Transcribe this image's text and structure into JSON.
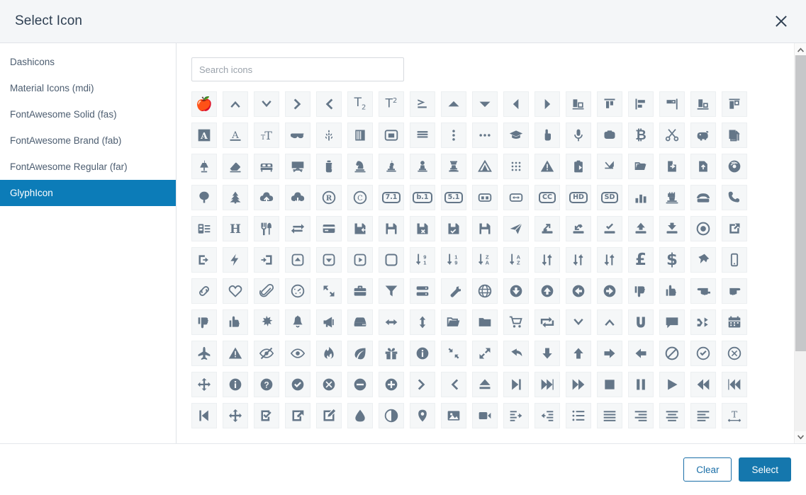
{
  "header": {
    "title": "Select Icon",
    "close_icon": "close-icon"
  },
  "sidebar": {
    "items": [
      {
        "label": "Dashicons",
        "active": false
      },
      {
        "label": "Material Icons (mdi)",
        "active": false
      },
      {
        "label": "FontAwesome Solid (fas)",
        "active": false
      },
      {
        "label": "FontAwesome Brand (fab)",
        "active": false
      },
      {
        "label": "FontAwesome Regular (far)",
        "active": false
      },
      {
        "label": "GlyphIcon",
        "active": true
      }
    ]
  },
  "search": {
    "placeholder": "Search icons",
    "value": ""
  },
  "footer": {
    "clear_label": "Clear",
    "select_label": "Select"
  },
  "colors": {
    "accent": "#0c7cb8",
    "button_primary": "#1577ad",
    "button_outline_text": "#1b6fa8",
    "header_bg": "#f4f6f8",
    "icon_fill": "#647688",
    "icon_cell_bg": "#f5f7f8",
    "title_text": "#2e3f52",
    "sidebar_text": "#4c5d70"
  },
  "scrollbar": {
    "up_arrow_icon": "chevron-up-icon",
    "down_arrow_icon": "chevron-down-icon",
    "thumb_position_percent": 0
  },
  "icon_grid": {
    "columns": 18,
    "font_set": "GlyphIcon",
    "icons": [
      "apple",
      "chevron-up",
      "chevron-down",
      "chevron-right",
      "chevron-left",
      "subscript",
      "superscript",
      "greater-than-equal-terminal",
      "triangle-up",
      "triangle-down",
      "triangle-left",
      "triangle-right",
      "object-align-bottom-right",
      "object-align-top",
      "object-align-left",
      "object-align-horizontal",
      "object-align-bottom",
      "object-align-vertical",
      "text-background",
      "text-color",
      "text-size",
      "sunglasses",
      "wheat",
      "book-binding",
      "modal-window",
      "menu-hamburger",
      "option-vertical",
      "option-horizontal",
      "education",
      "thumbnail-hand",
      "microphone",
      "piggy-bank-side",
      "bitcoin",
      "scissors-cut",
      "piggy-bank",
      "copy-duplicate",
      "lamp",
      "eraser",
      "bed",
      "blackboard",
      "baby-formula",
      "knight",
      "king",
      "pawn",
      "queen",
      "tent",
      "grid-dots",
      "alert-triangle",
      "paste",
      "cut",
      "open-file",
      "import",
      "export",
      "cd",
      "tree-deciduous",
      "tree-conifer",
      "cloud-upload",
      "cloud-download",
      "registration-mark",
      "copyright-mark",
      "btc-7-1",
      "btc-b-1",
      "btc-5-1",
      "subtitles",
      "resize-horizontal-badge",
      "cc-badge",
      "hd-video",
      "sd-video",
      "stats",
      "tower",
      "phone-alt",
      "phone",
      "list-alt-settings",
      "header",
      "cutlery",
      "transfer",
      "credit-card",
      "save-file",
      "save-floppy",
      "save-cancel",
      "save-check",
      "floppy-disk",
      "send",
      "open-remote",
      "import-file",
      "floppy-saved",
      "floppy-open",
      "floppy-save",
      "record",
      "new-window",
      "log-out",
      "flash",
      "log-in",
      "collapse-up",
      "collapse-down",
      "play-circle",
      "unchecked",
      "sort-by-attributes",
      "sort-by-attributes-alt",
      "sort-by-order",
      "sort-by-order-alt",
      "sort-by-alphabet",
      "sort-by-alphabet-alt",
      "sort",
      "gbp",
      "usd",
      "pushpin",
      "phone-mobile",
      "link",
      "heart-empty",
      "paperclip",
      "dashboard",
      "fullscreen",
      "briefcase",
      "filter",
      "hdd-stack",
      "wrench",
      "globe-settings",
      "circle-arrow-down",
      "circle-arrow-up",
      "circle-arrow-left",
      "circle-arrow-right",
      "thumbs-down-alt",
      "hand-up-alt",
      "hand-left",
      "hand-right",
      "thumbs-down",
      "thumbs-up",
      "asterisk-burst",
      "bell",
      "bullhorn",
      "hdd",
      "resize-horizontal",
      "resize-vertical",
      "folder-open",
      "folder-close",
      "shopping-cart",
      "retweet",
      "chevron-down-wide",
      "chevron-up-wide",
      "magnet",
      "comment",
      "random",
      "calendar",
      "plane",
      "warning-sign",
      "eye-close",
      "eye-open",
      "fire",
      "leaf",
      "gift",
      "info-sign",
      "resize-small",
      "resize-full",
      "share",
      "arrow-down",
      "arrow-up",
      "arrow-right",
      "arrow-left",
      "ban-circle",
      "ok-circle",
      "remove-circle",
      "move",
      "info-circle",
      "question-sign",
      "ok-sign",
      "remove-sign",
      "minus-sign",
      "plus-sign",
      "forward-chevron",
      "backward-chevron",
      "eject",
      "step-forward",
      "fast-forward",
      "forward",
      "stop",
      "pause",
      "play",
      "backward",
      "fast-backward",
      "step-backward",
      "move-arrows",
      "check-box",
      "share-alt",
      "edit",
      "tint",
      "adjust",
      "map-marker",
      "picture",
      "facetime-video",
      "indent-right",
      "indent-left",
      "list",
      "align-justify",
      "align-right",
      "align-center",
      "align-left",
      "text-width"
    ]
  }
}
